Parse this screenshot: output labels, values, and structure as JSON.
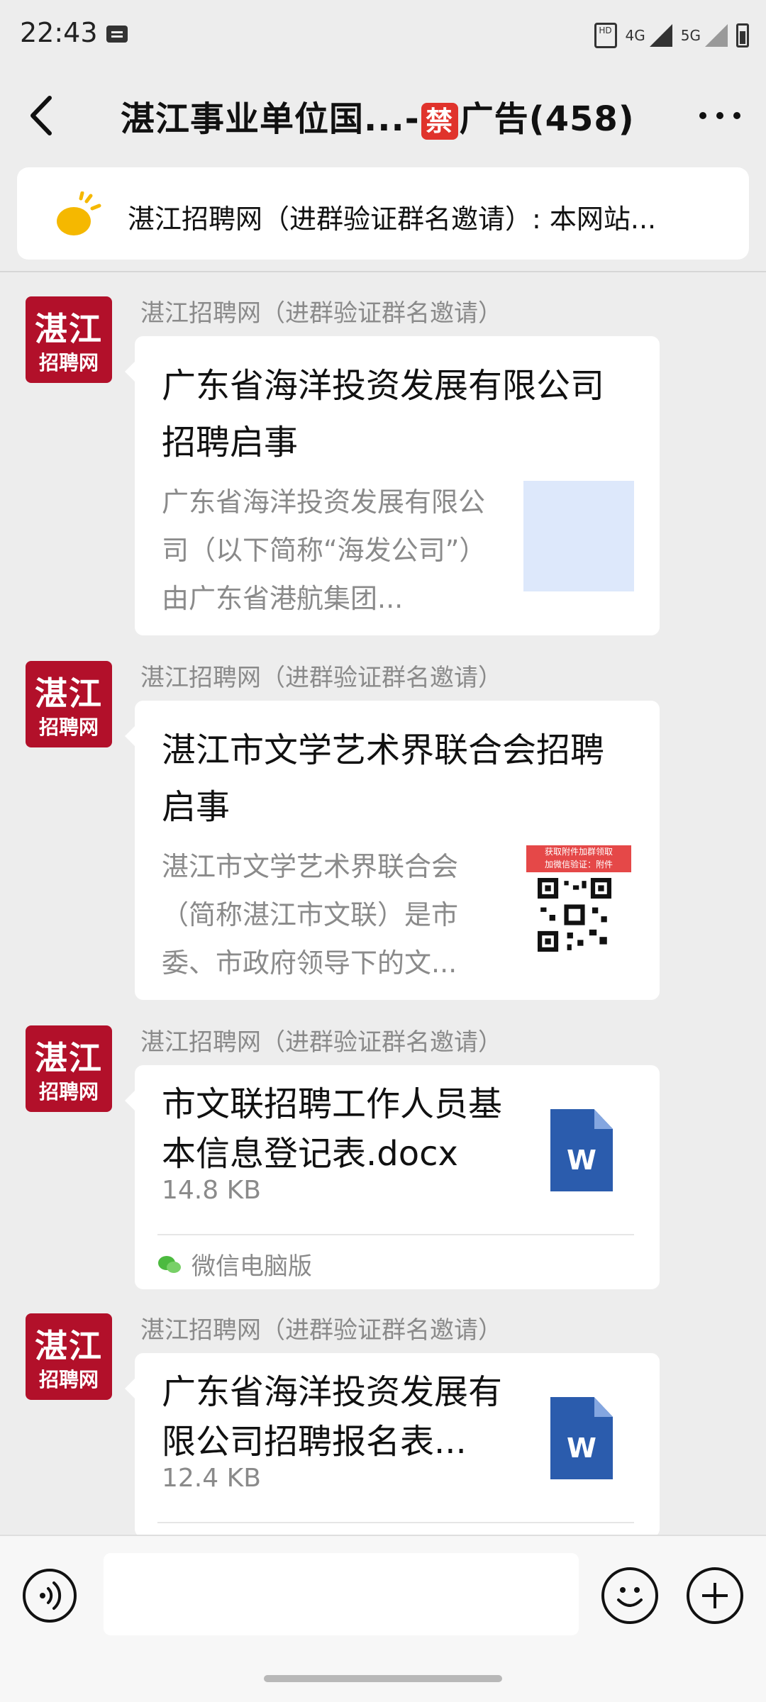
{
  "status_bar": {
    "time": "22:43",
    "network_1": "4G",
    "network_2": "5G",
    "hd_label": "HD"
  },
  "header": {
    "title_prefix": "湛江事业单位国...-",
    "ban_glyph": "禁",
    "title_suffix": "广告(458)",
    "back_icon": "chevron-left-icon",
    "more_icon": "more-horizontal-icon"
  },
  "pinned_notice": {
    "text": "湛江招聘网（进群验证群名邀请）: 本网站...",
    "icon": "announcement-bulb-icon"
  },
  "avatar": {
    "line1": "湛江",
    "line2": "招聘网",
    "color": "#b2102a"
  },
  "messages": [
    {
      "sender": "湛江招聘网（进群验证群名邀请）",
      "type": "article",
      "title": "广东省海洋投资发展有限公司招聘启事",
      "description": "广东省海洋投资发展有限公司（以下简称“海发公司”）由广东省港航集团...",
      "thumbnail": "blank-thumbnail"
    },
    {
      "sender": "湛江招聘网（进群验证群名邀请）",
      "type": "article",
      "title": "湛江市文学艺术界联合会招聘启事",
      "description": "湛江市文学艺术界联合会（简称湛江市文联）是市委、市政府领导下的文...",
      "thumbnail": "qr-code-thumbnail",
      "thumb_caption_1": "获取附件加群领取",
      "thumb_caption_2": "加微信验证：附件"
    },
    {
      "sender": "湛江招聘网（进群验证群名邀请）",
      "type": "file",
      "title": "市文联招聘工作人员基本信息登记表.docx",
      "size": "14.8 KB",
      "file_icon_letter": "W",
      "source": "微信电脑版"
    },
    {
      "sender": "湛江招聘网（进群验证群名邀请）",
      "type": "file",
      "title": "广东省海洋投资发展有限公司招聘报名表...",
      "size": "12.4 KB",
      "file_icon_letter": "W"
    }
  ],
  "input_bar": {
    "voice_icon": "voice-icon",
    "emoji_icon": "emoji-icon",
    "plus_icon": "plus-icon"
  }
}
